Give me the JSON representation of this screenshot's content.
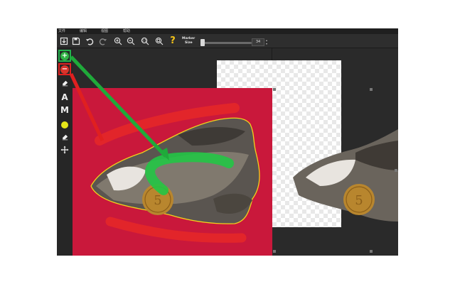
{
  "menu": {
    "items": [
      {
        "label": "文件"
      },
      {
        "label": "编辑"
      },
      {
        "label": "视图"
      },
      {
        "label": "帮助"
      }
    ]
  },
  "toolbar": {
    "open_icon": "open-file-icon",
    "save_icon": "save-icon",
    "undo_icon": "undo-icon",
    "redo_icon": "redo-icon",
    "zoom_in_icon": "zoom-in-icon",
    "zoom_out_icon": "zoom-out-icon",
    "zoom_actual_icon": "zoom-actual-icon",
    "zoom_fit_icon": "zoom-fit-icon",
    "help_label": "?",
    "marker_label_line1": "Marker",
    "marker_label_line2": "Size",
    "marker_size_value": "34"
  },
  "tools": {
    "keep_icon": "plus-circle-icon",
    "remove_icon": "minus-circle-icon",
    "eraser_icon": "eraser-icon",
    "letter_a": "A",
    "letter_m": "M",
    "color_icon": "yellow-dot-icon",
    "eraser2_icon": "eraser-icon",
    "move_icon": "move-icon",
    "plus": "+",
    "minus": "−"
  },
  "colors": {
    "keep_marker": "#22b14c",
    "remove_marker": "#e02020",
    "outline": "#f2d21b",
    "backdrop": "#d7193f"
  }
}
